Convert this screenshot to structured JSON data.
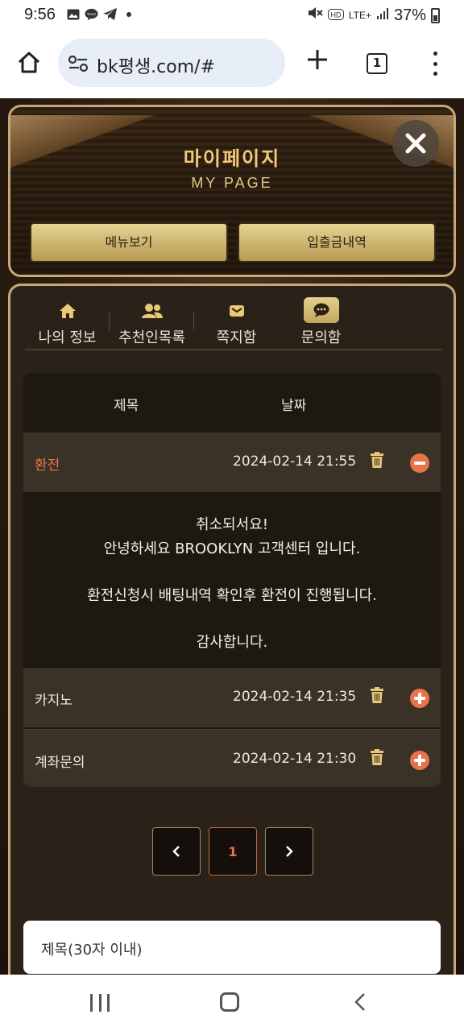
{
  "status_bar": {
    "time": "9:56",
    "battery": "37%",
    "network": "LTE+",
    "icons": [
      "gallery-icon",
      "talk-icon",
      "telegram-icon",
      "dot-icon",
      "mute-icon",
      "hd-icon",
      "signal-icon",
      "battery-icon"
    ]
  },
  "browser": {
    "url": "bk평생.com/#",
    "tab_count": "1"
  },
  "header": {
    "title_ko": "마이페이지",
    "title_en": "MY PAGE",
    "menu_button": "메뉴보기",
    "history_button": "입출금내역"
  },
  "tabs": [
    {
      "label": "나의 정보",
      "icon": "home-icon"
    },
    {
      "label": "추천인목록",
      "icon": "users-icon"
    },
    {
      "label": "쪽지함",
      "icon": "envelope-icon"
    },
    {
      "label": "문의함",
      "icon": "chat-icon",
      "active": true
    }
  ],
  "table": {
    "col_title": "제목",
    "col_date": "날짜",
    "rows": [
      {
        "title": "환전",
        "date": "2024-02-14 21:55",
        "expanded": true
      },
      {
        "title": "카지노",
        "date": "2024-02-14 21:35",
        "expanded": false
      },
      {
        "title": "계좌문의",
        "date": "2024-02-14 21:30",
        "expanded": false
      }
    ],
    "message": {
      "line1": "취소되서요!",
      "line2": "안녕하세요 BROOKLYN 고객센터 입니다.",
      "line3": "환전신청시 배팅내역 확인후 환전이 진행됩니다.",
      "line4": "감사합니다."
    }
  },
  "pagination": {
    "current": "1"
  },
  "form": {
    "title_placeholder": "제목(30자 이내)"
  },
  "colors": {
    "accent": "#e8734a",
    "gold": "#c9a878",
    "gold_button": "#d9c27a"
  }
}
